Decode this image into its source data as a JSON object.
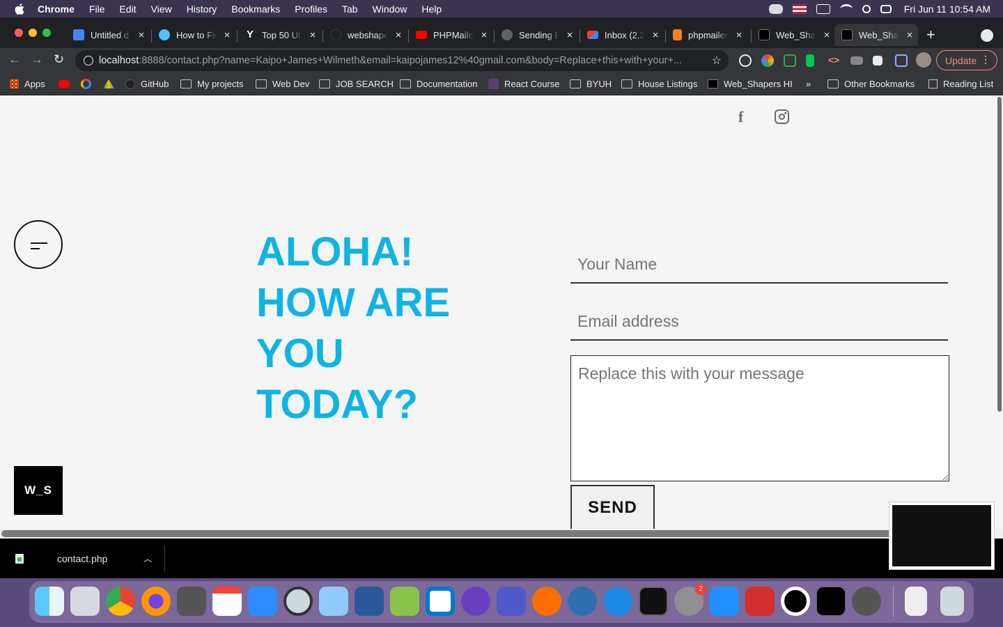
{
  "menubar": {
    "app": "Chrome",
    "items": [
      "File",
      "Edit",
      "View",
      "History",
      "Bookmarks",
      "Profiles",
      "Tab",
      "Window",
      "Help"
    ],
    "clock": "Fri Jun 11  10:54 AM"
  },
  "tabs": [
    {
      "label": "Untitled d",
      "icon": "google-docs-icon",
      "color": "#4285f4"
    },
    {
      "label": "How to Fin",
      "icon": "medium-m-icon",
      "color": "#4fc3f7"
    },
    {
      "label": "Top 50 Ut",
      "icon": "yelp-y-icon",
      "color": "#202124"
    },
    {
      "label": "webshape",
      "icon": "github-icon",
      "color": "#202124"
    },
    {
      "label": "PHPMailer",
      "icon": "youtube-icon",
      "color": "#ff0000"
    },
    {
      "label": "Sending E",
      "icon": "sending-icon",
      "color": "#5f6368"
    },
    {
      "label": "Inbox (2,2",
      "icon": "gmail-icon",
      "color": "#ea4335"
    },
    {
      "label": "phpmailer",
      "icon": "stackoverflow-icon",
      "color": "#f48024"
    },
    {
      "label": "Web_Shap",
      "icon": "web-shapers-icon",
      "color": "#000000"
    },
    {
      "label": "Web_Shap",
      "icon": "web-shapers-icon",
      "color": "#000000"
    }
  ],
  "url": {
    "host": "localhost",
    "rest": ":8888/contact.php?name=Kaipo+James+Wilmeth&email=kaipojames12%40gmail.com&body=Replace+this+with+your+..."
  },
  "update_label": "Update",
  "bookmarks": [
    {
      "label": "Apps",
      "icon": "apps-grid-icon"
    },
    {
      "label": "",
      "icon": "youtube-icon"
    },
    {
      "label": "",
      "icon": "google-icon"
    },
    {
      "label": "",
      "icon": "google-drive-icon"
    },
    {
      "label": "GitHub",
      "icon": "github-icon"
    },
    {
      "label": "My projects",
      "icon": "folder-icon"
    },
    {
      "label": "Web Dev",
      "icon": "folder-icon"
    },
    {
      "label": "JOB SEARCH",
      "icon": "folder-icon"
    },
    {
      "label": "Documentation",
      "icon": "folder-icon"
    },
    {
      "label": "React Course",
      "icon": "react-course-icon"
    },
    {
      "label": "BYUH",
      "icon": "folder-icon"
    },
    {
      "label": "House Listings",
      "icon": "folder-icon"
    },
    {
      "label": "Web_Shapers HI",
      "icon": "web-shapers-icon"
    },
    {
      "label": "»",
      "icon": ""
    },
    {
      "label": "Other Bookmarks",
      "icon": "folder-icon"
    },
    {
      "label": "Reading List",
      "icon": "reading-list-icon"
    }
  ],
  "page": {
    "headline": [
      "ALOHA!",
      "HOW ARE",
      "YOU",
      "TODAY?"
    ],
    "accent_color": "#0fb4e3",
    "logo_text": "W_S",
    "form": {
      "name_placeholder": "Your Name",
      "email_placeholder": "Email address",
      "message_placeholder": "Replace this with your message",
      "send_label": "SEND"
    }
  },
  "download": {
    "filename": "contact.php"
  },
  "dock": {
    "badge": "2"
  }
}
